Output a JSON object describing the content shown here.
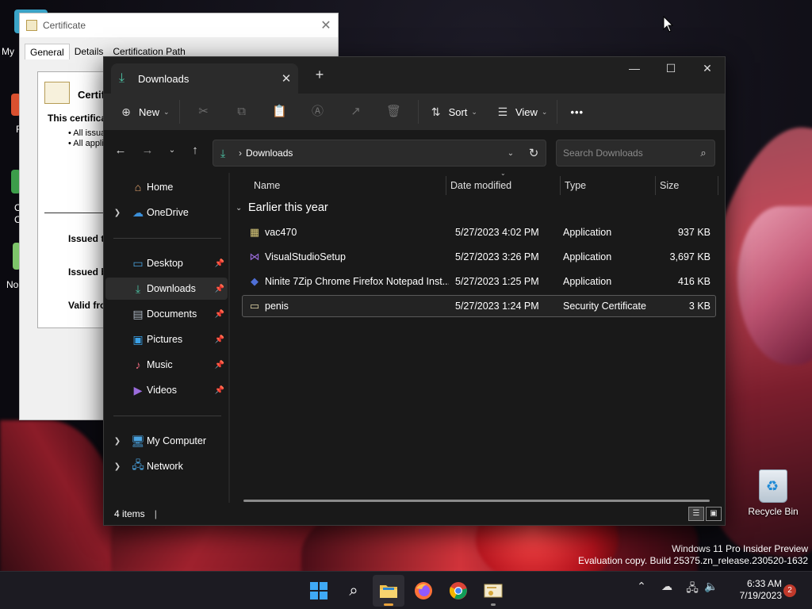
{
  "desktop": {
    "recycle_bin_label": "Recycle Bin",
    "watermark_line1": "Windows 11 Pro Insider Preview",
    "watermark_line2": "Evaluation copy. Build 25375.zn_release.230520-1632",
    "left_icon_labels": [
      "My",
      "F",
      "C",
      "C",
      "No"
    ]
  },
  "certificate_dialog": {
    "title": "Certificate",
    "tabs": [
      "General",
      "Details",
      "Certification Path"
    ],
    "heading": "Certifi",
    "purpose_text": "This certifica",
    "bullets": [
      "• All issua",
      "• All appli"
    ],
    "fields": [
      "Issued t",
      "Issued b",
      "Valid fro"
    ]
  },
  "explorer": {
    "tab_title": "Downloads",
    "new_tab": "+",
    "window_controls": {
      "minimize": "—",
      "maximize": "☐",
      "close": "✕"
    },
    "toolbar": {
      "new_label": "New",
      "sort_label": "Sort",
      "view_label": "View",
      "more_label": "•••"
    },
    "address": {
      "path": "Downloads"
    },
    "search": {
      "placeholder": "Search Downloads"
    },
    "sidebar": {
      "quick": [
        {
          "label": "Home",
          "icon": "home-icon",
          "expandable": false
        },
        {
          "label": "OneDrive",
          "icon": "cloud-icon",
          "expandable": true
        }
      ],
      "pinned": [
        {
          "label": "Desktop",
          "icon": "desktop-icon"
        },
        {
          "label": "Downloads",
          "icon": "download-icon",
          "selected": true
        },
        {
          "label": "Documents",
          "icon": "document-icon"
        },
        {
          "label": "Pictures",
          "icon": "picture-icon"
        },
        {
          "label": "Music",
          "icon": "music-icon"
        },
        {
          "label": "Videos",
          "icon": "video-icon"
        }
      ],
      "locations": [
        {
          "label": "My Computer",
          "icon": "computer-icon"
        },
        {
          "label": "Network",
          "icon": "network-icon"
        }
      ]
    },
    "columns": {
      "name": "Name",
      "date": "Date modified",
      "type": "Type",
      "size": "Size"
    },
    "group_label": "Earlier this year",
    "files": [
      {
        "name": "vac470",
        "date": "5/27/2023 4:02 PM",
        "type": "Application",
        "size": "937 KB",
        "icon": "app-icon"
      },
      {
        "name": "VisualStudioSetup",
        "date": "5/27/2023 3:26 PM",
        "type": "Application",
        "size": "3,697 KB",
        "icon": "visual-studio-icon"
      },
      {
        "name": "Ninite 7Zip Chrome Firefox Notepad Inst...",
        "date": "5/27/2023 1:25 PM",
        "type": "Application",
        "size": "416 KB",
        "icon": "ninite-icon"
      },
      {
        "name": "penis",
        "date": "5/27/2023 1:24 PM",
        "type": "Security Certificate",
        "size": "3 KB",
        "icon": "certificate-icon",
        "selected": true
      }
    ],
    "status": {
      "item_count": "4 items"
    }
  },
  "taskbar": {
    "clock_time": "6:33 AM",
    "clock_date": "7/19/2023",
    "notification_count": "2"
  },
  "colors": {
    "accent_teal": "#4cc2a4",
    "taskbar_indicator": "#e9a23b",
    "explorer_bg": "#191919",
    "toolbar_bg": "#2b2b2b"
  }
}
